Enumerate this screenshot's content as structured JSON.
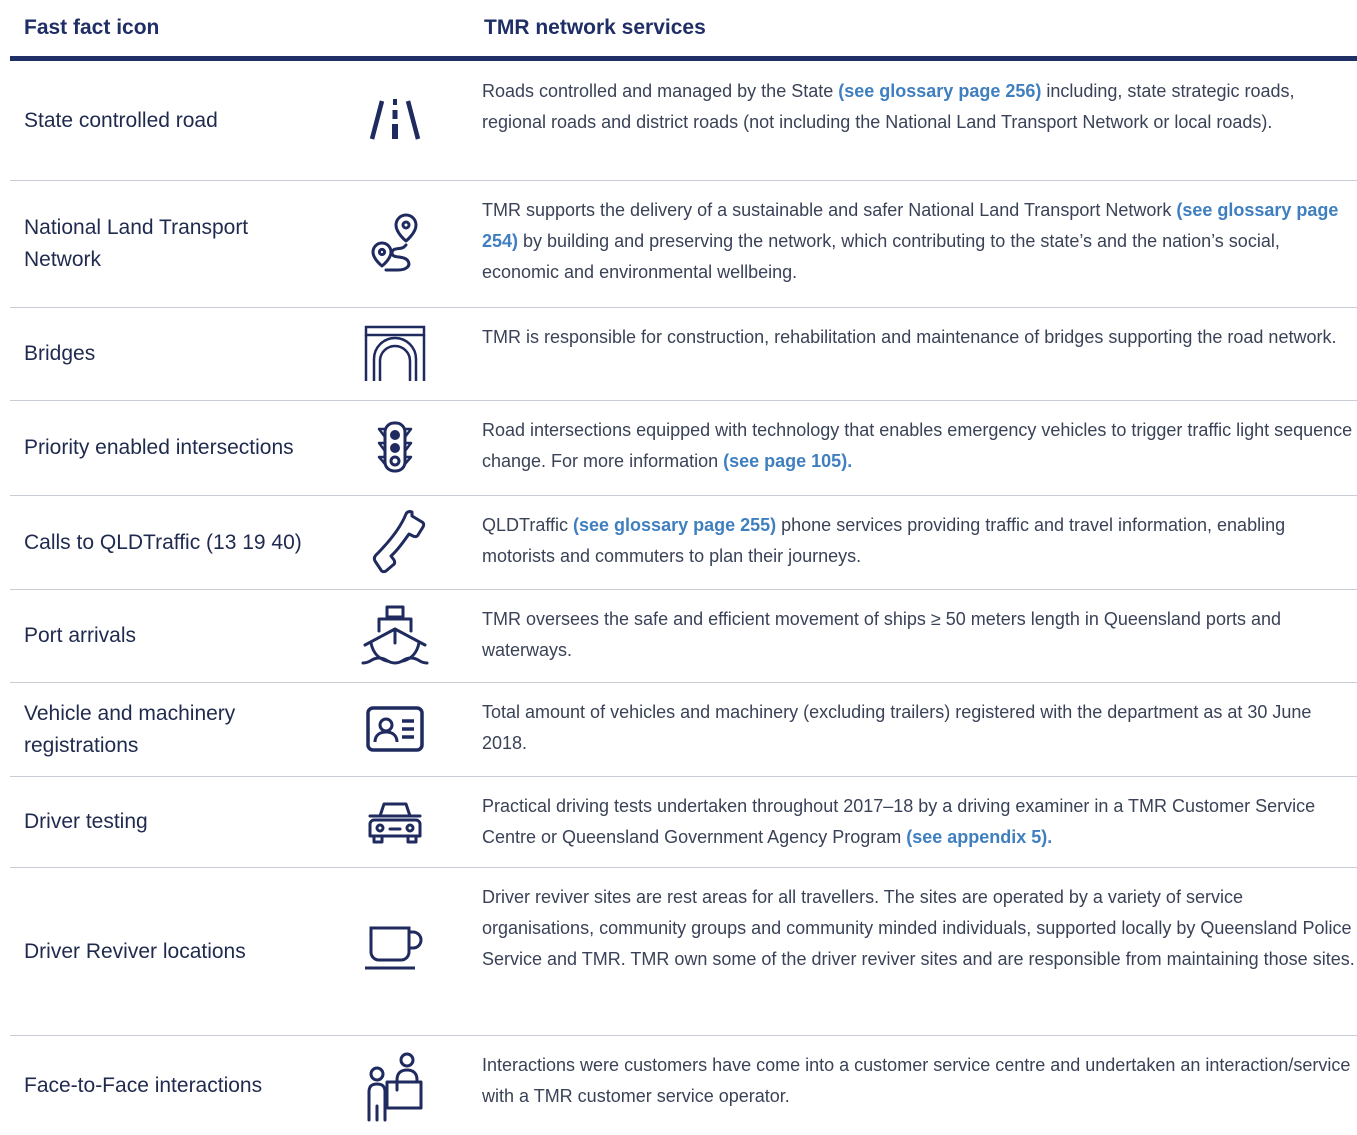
{
  "header": {
    "col1": "Fast fact icon",
    "col2": "TMR network services"
  },
  "colors": {
    "heading": "#1f2f66",
    "rule": "#1f3067",
    "link": "#3f7fbf",
    "text": "#3a4257"
  },
  "rows": [
    {
      "name": "State controlled road",
      "icon": "road-icon",
      "desc": [
        {
          "t": "Roads controlled and managed by the State "
        },
        {
          "t": "(see glossary page 256)",
          "link": true
        },
        {
          "t": " including, state strategic roads, regional roads and district roads (not including the National Land Transport Network or local roads)."
        }
      ]
    },
    {
      "name": "National Land Transport Network",
      "icon": "route-icon",
      "desc": [
        {
          "t": "TMR supports the delivery of a sustainable and safer National Land Transport Network "
        },
        {
          "t": "(see glossary page 254)",
          "link": true
        },
        {
          "t": " by building and preserving the network, which contributing to the state’s and the nation’s social, economic and environmental wellbeing."
        }
      ]
    },
    {
      "name": "Bridges",
      "icon": "bridge-icon",
      "desc": [
        {
          "t": "TMR is responsible for construction, rehabilitation and maintenance of bridges supporting the road network."
        }
      ]
    },
    {
      "name": "Priority enabled intersections",
      "icon": "traffic-light-icon",
      "desc": [
        {
          "t": "Road intersections equipped with technology that enables emergency vehicles to trigger traffic light sequence change. For more information "
        },
        {
          "t": "(see page 105).",
          "link": true
        }
      ]
    },
    {
      "name": "Calls to QLDTraffic (13 19 40)",
      "icon": "phone-icon",
      "desc": [
        {
          "t": "QLDTraffic "
        },
        {
          "t": "(see glossary page 255)",
          "link": true
        },
        {
          "t": " phone services providing traffic and travel information, enabling motorists and commuters to plan their journeys."
        }
      ]
    },
    {
      "name": "Port arrivals",
      "icon": "ship-icon",
      "desc": [
        {
          "t": "TMR oversees the safe and efficient movement of ships ≥ 50 meters length in Queensland ports and waterways."
        }
      ]
    },
    {
      "name": "Vehicle and machinery registrations",
      "icon": "registration-card-icon",
      "desc": [
        {
          "t": "Total amount of vehicles and machinery (excluding trailers) registered with the department as at 30 June 2018."
        }
      ]
    },
    {
      "name": "Driver testing",
      "icon": "car-icon",
      "desc": [
        {
          "t": "Practical driving tests undertaken throughout 2017–18 by a driving examiner in a TMR Customer Service Centre or Queensland Government Agency Program "
        },
        {
          "t": "(see appendix 5).",
          "link": true
        }
      ]
    },
    {
      "name": "Driver Reviver locations",
      "icon": "coffee-cup-icon",
      "desc": [
        {
          "t": "Driver reviver sites are rest areas for all travellers. The sites are operated by a variety of service organisations, community groups and community minded individuals, supported locally by Queensland Police Service and TMR. TMR own some of the driver reviver sites and are responsible from maintaining those sites."
        }
      ]
    },
    {
      "name": "Face-to-Face interactions",
      "icon": "customer-service-icon",
      "desc": [
        {
          "t": "Interactions were customers have come into a customer service centre and undertaken an interaction/service with a TMR customer service operator."
        }
      ]
    }
  ]
}
